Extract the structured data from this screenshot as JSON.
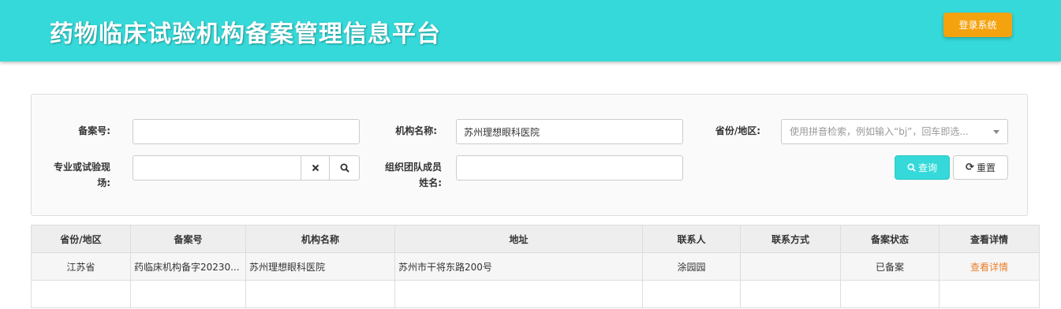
{
  "header": {
    "title": "药物临床试验机构备案管理信息平台",
    "login_label": "登录系统"
  },
  "search": {
    "record_no_label": "备案号:",
    "record_no_value": "",
    "org_name_label": "机构名称:",
    "org_name_value": "苏州理想眼科医院",
    "province_label": "省份/地区:",
    "province_placeholder": "使用拼音检索，例如输入“bj”，回车即选...",
    "major_label": "专业或试验现场:",
    "major_value": "",
    "team_label": "组织团队成员姓名:",
    "team_value": "",
    "query_label": "查询",
    "reset_label": "重置"
  },
  "table": {
    "headers": [
      "省份/地区",
      "备案号",
      "机构名称",
      "地址",
      "联系人",
      "联系方式",
      "备案状态",
      "查看详情"
    ],
    "rows": [
      {
        "province": "江苏省",
        "record_no": "药临床机构备字20230...",
        "org_name": "苏州理想眼科医院",
        "address": "苏州市干将东路200号",
        "contact": "涂园园",
        "phone": "",
        "status": "已备案",
        "detail": "查看详情"
      }
    ]
  },
  "colors": {
    "header_bg": "#35d9d9",
    "login_button": "#f5a20f",
    "detail_link": "#e97f2c"
  }
}
